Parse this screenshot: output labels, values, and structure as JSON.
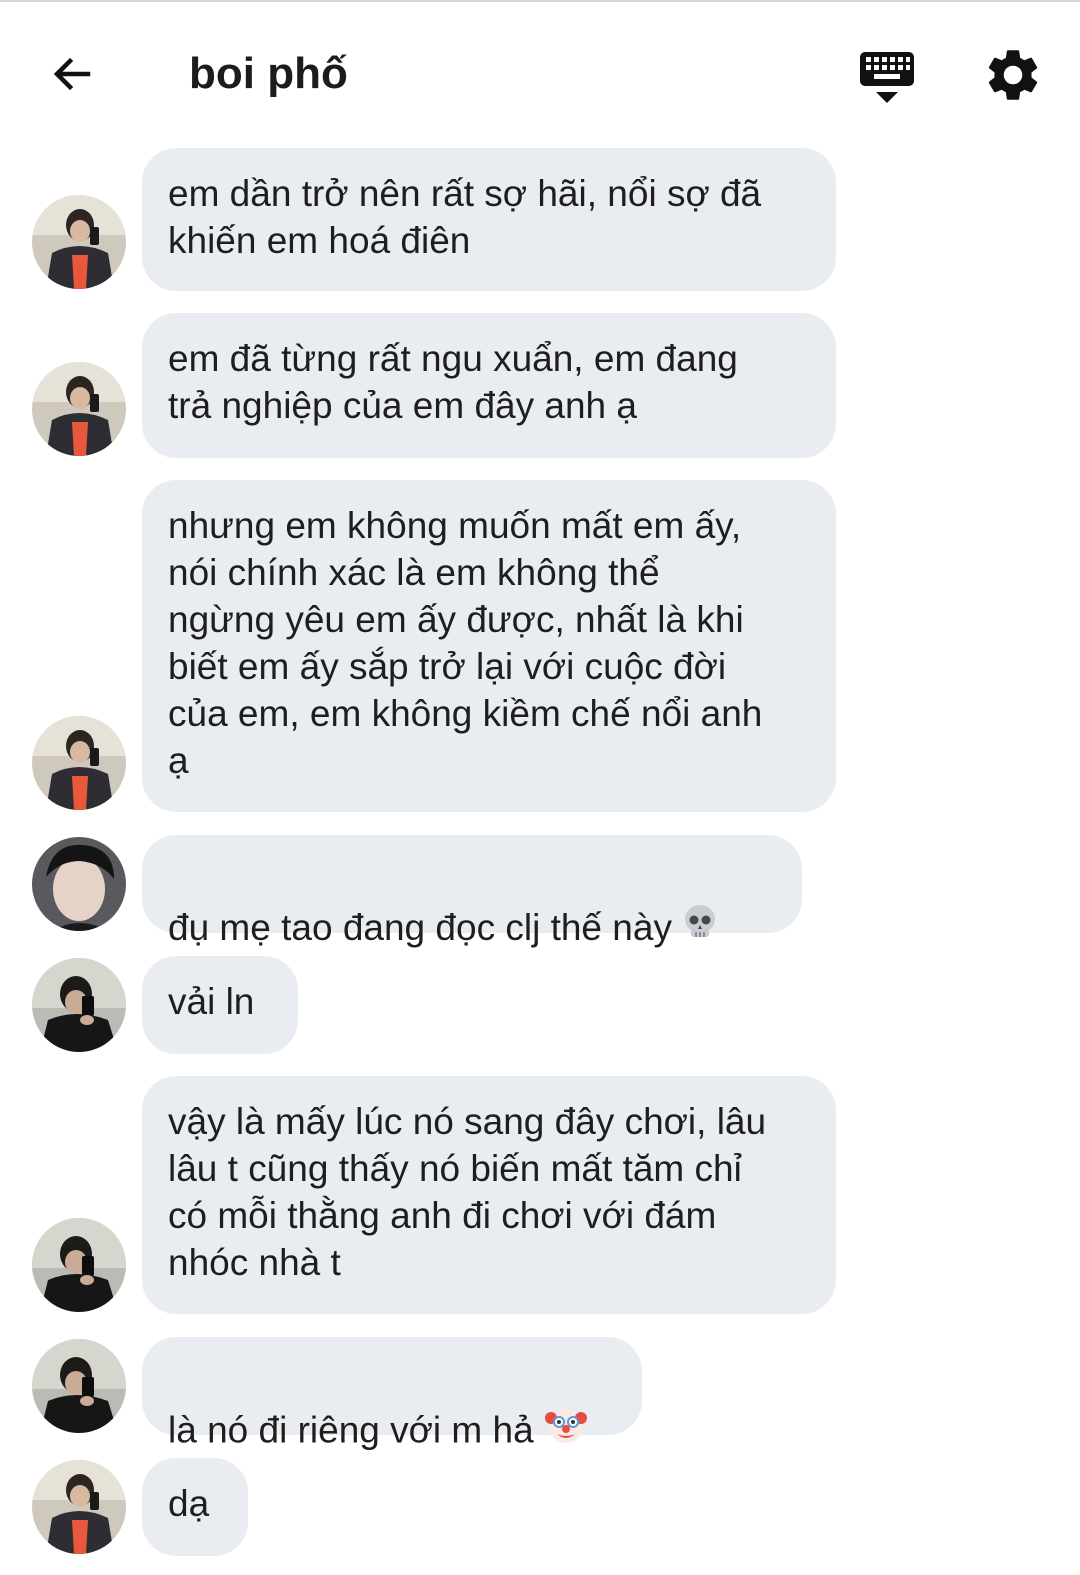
{
  "header": {
    "title": "boi phố",
    "back_icon": "arrow-left-icon",
    "keyboard_icon": "keyboard-icon",
    "settings_icon": "gear-icon"
  },
  "messages": [
    {
      "avatar": "avatar-a",
      "text": "em dần trở nên rất sợ hãi, nổi sợ đã\nkhiến em hoá điên"
    },
    {
      "avatar": "avatar-a",
      "text": "em đã từng rất ngu xuẩn, em đang\ntrả nghiệp của em đây anh ạ"
    },
    {
      "avatar": "avatar-a",
      "text": "nhưng em không muốn mất em ấy,\nnói chính xác là em không thể\nngừng yêu em ấy được, nhất là khi\nbiết em ấy sắp trở lại với cuộc đời\ncủa em, em không kiềm chế nổi anh\nạ"
    },
    {
      "avatar": "avatar-b",
      "text": "đụ mẹ tao đang đọc clj thế này",
      "emoji": "skull-emoji"
    },
    {
      "avatar": "avatar-c",
      "text": "vải ln"
    },
    {
      "avatar": "avatar-c",
      "text": "vậy là mấy lúc nó sang đây chơi, lâu\nlâu t cũng thấy nó biến mất tăm chỉ\ncó mỗi thằng anh đi chơi với đám\nnhóc nhà t"
    },
    {
      "avatar": "avatar-c",
      "text": "là nó đi riêng với m hả",
      "emoji": "clown-face-emoji"
    },
    {
      "avatar": "avatar-a",
      "text": "dạ"
    }
  ],
  "colors": {
    "bubble": "#e9edf1",
    "text": "#1e1e1e",
    "background": "#ffffff"
  }
}
